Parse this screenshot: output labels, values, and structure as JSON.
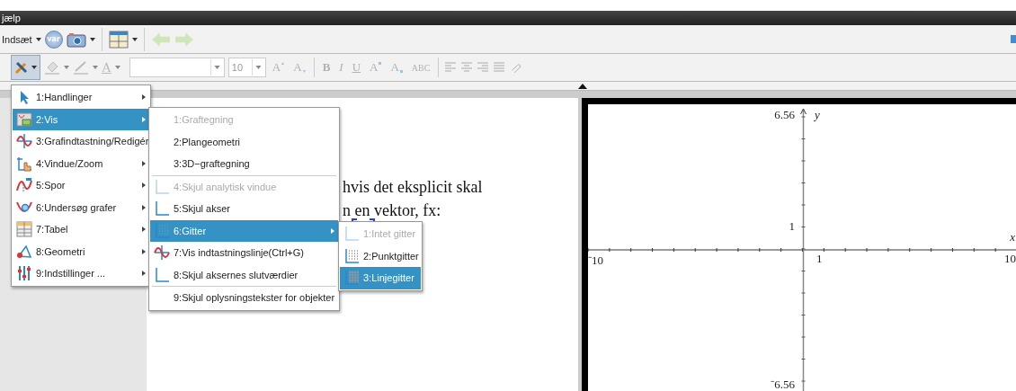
{
  "title_bar": {
    "text": "jælp"
  },
  "toolbar": {
    "insert_label": "Indsæt",
    "var_label": "var"
  },
  "format_bar": {
    "tools_active": true,
    "text_color_label": "A",
    "font_size": "10",
    "buttons": [
      {
        "label": "A",
        "kind": "grow",
        "disabled": true
      },
      {
        "label": "A",
        "kind": "shrink",
        "disabled": true
      },
      {
        "label": "B",
        "kind": "bold",
        "disabled": true
      },
      {
        "label": "I",
        "kind": "italic",
        "disabled": true
      },
      {
        "label": "U",
        "kind": "underline",
        "disabled": true
      },
      {
        "label": "A",
        "kind": "superscript",
        "disabled": true
      },
      {
        "label": "A",
        "kind": "subscript",
        "disabled": true
      },
      {
        "label": "ABC",
        "kind": "strike",
        "disabled": true
      }
    ]
  },
  "document": {
    "lines": [
      "hvis det eksplicit skal",
      "n en vektor, fx:"
    ]
  },
  "graph": {
    "y_max": "6.56",
    "y_unit": "1",
    "y_min": "⁻6.56",
    "x_min": "⁻10",
    "x_unit": "1",
    "x_max": "10",
    "x_axis": "x",
    "y_axis": "y"
  },
  "menu": {
    "items": [
      {
        "label": "1:Handlinger",
        "selected": false
      },
      {
        "label": "2:Vis",
        "selected": true
      },
      {
        "label": "3:Grafindtastning/Redigér",
        "selected": false
      },
      {
        "label": "4:Vindue/Zoom",
        "selected": false
      },
      {
        "label": "5:Spor",
        "selected": false
      },
      {
        "label": "6:Undersøg grafer",
        "selected": false
      },
      {
        "label": "7:Tabel",
        "selected": false
      },
      {
        "label": "8:Geometri",
        "selected": false
      },
      {
        "label": "9:Indstillinger ...",
        "selected": false
      }
    ]
  },
  "submenu": {
    "items": [
      {
        "kind": "item",
        "label": "1:Graftegning",
        "selected": false,
        "disabled": true,
        "has_submenu": false
      },
      {
        "kind": "item",
        "label": "2:Plangeometri",
        "selected": false,
        "disabled": false,
        "has_submenu": false
      },
      {
        "kind": "item",
        "label": "3:3D−graftegning",
        "selected": false,
        "disabled": false,
        "has_submenu": false
      },
      {
        "kind": "divider"
      },
      {
        "kind": "item",
        "label": "4:Skjul analytisk vindue",
        "selected": false,
        "disabled": true,
        "has_submenu": false
      },
      {
        "kind": "item",
        "label": "5:Skjul akser",
        "selected": false,
        "disabled": false,
        "has_submenu": false
      },
      {
        "kind": "item",
        "label": "6:Gitter",
        "selected": true,
        "disabled": false,
        "has_submenu": true
      },
      {
        "kind": "item",
        "label": "7:Vis indtastningslinje(Ctrl+G)",
        "selected": false,
        "disabled": false,
        "has_submenu": false
      },
      {
        "kind": "item",
        "label": "8:Skjul aksernes slutværdier",
        "selected": false,
        "disabled": false,
        "has_submenu": false
      },
      {
        "kind": "divider"
      },
      {
        "kind": "item",
        "label": "9:Skjul oplysningstekster for objekter",
        "selected": false,
        "disabled": false,
        "has_submenu": false
      }
    ]
  },
  "grid_menu": {
    "items": [
      {
        "label": "1:Intet gitter",
        "selected": false,
        "disabled": true
      },
      {
        "label": "2:Punktgitter",
        "selected": false,
        "disabled": false
      },
      {
        "label": "3:Linjegitter",
        "selected": true,
        "disabled": false
      }
    ]
  }
}
